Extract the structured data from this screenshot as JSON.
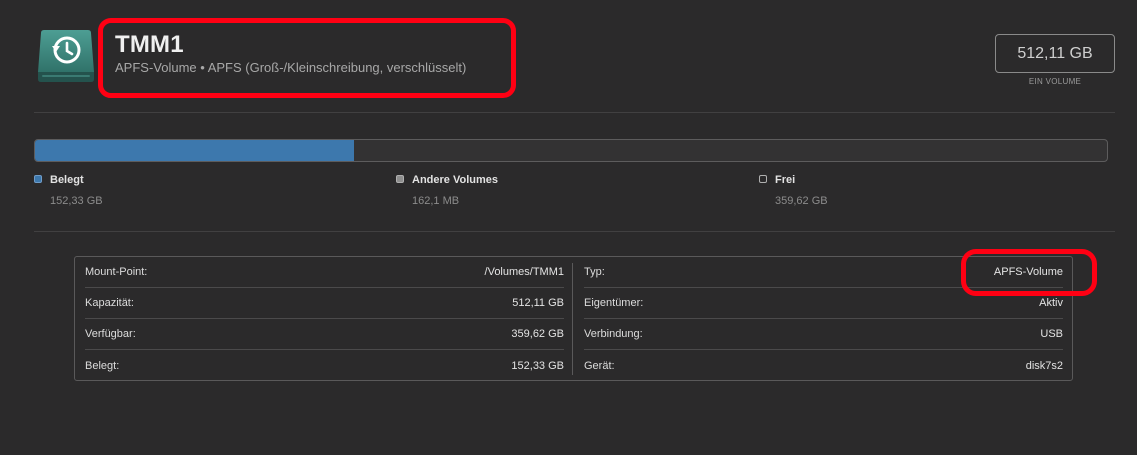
{
  "header": {
    "title": "TMM1",
    "subtitle": "APFS-Volume • APFS (Groß-/Kleinschreibung, verschlüsselt)",
    "icon": "time-machine-drive-icon"
  },
  "capacity": {
    "value": "512,11 GB",
    "caption": "EIN VOLUME"
  },
  "usage": {
    "used_fraction": 0.2975,
    "colors": {
      "used": "#3d78ad",
      "other": "#8e8e8e",
      "free": "#2b2a2b"
    },
    "legend": [
      {
        "label": "Belegt",
        "value": "152,33 GB"
      },
      {
        "label": "Andere Volumes",
        "value": "162,1 MB"
      },
      {
        "label": "Frei",
        "value": "359,62 GB"
      }
    ]
  },
  "info": {
    "left": [
      {
        "label": "Mount-Point:",
        "value": "/Volumes/TMM1"
      },
      {
        "label": "Kapazität:",
        "value": "512,11 GB"
      },
      {
        "label": "Verfügbar:",
        "value": "359,62 GB"
      },
      {
        "label": "Belegt:",
        "value": "152,33 GB"
      }
    ],
    "right": [
      {
        "label": "Typ:",
        "value": "APFS-Volume"
      },
      {
        "label": "Eigentümer:",
        "value": "Aktiv"
      },
      {
        "label": "Verbindung:",
        "value": "USB"
      },
      {
        "label": "Gerät:",
        "value": "disk7s2"
      }
    ]
  },
  "annotation_color": "#ff0013"
}
